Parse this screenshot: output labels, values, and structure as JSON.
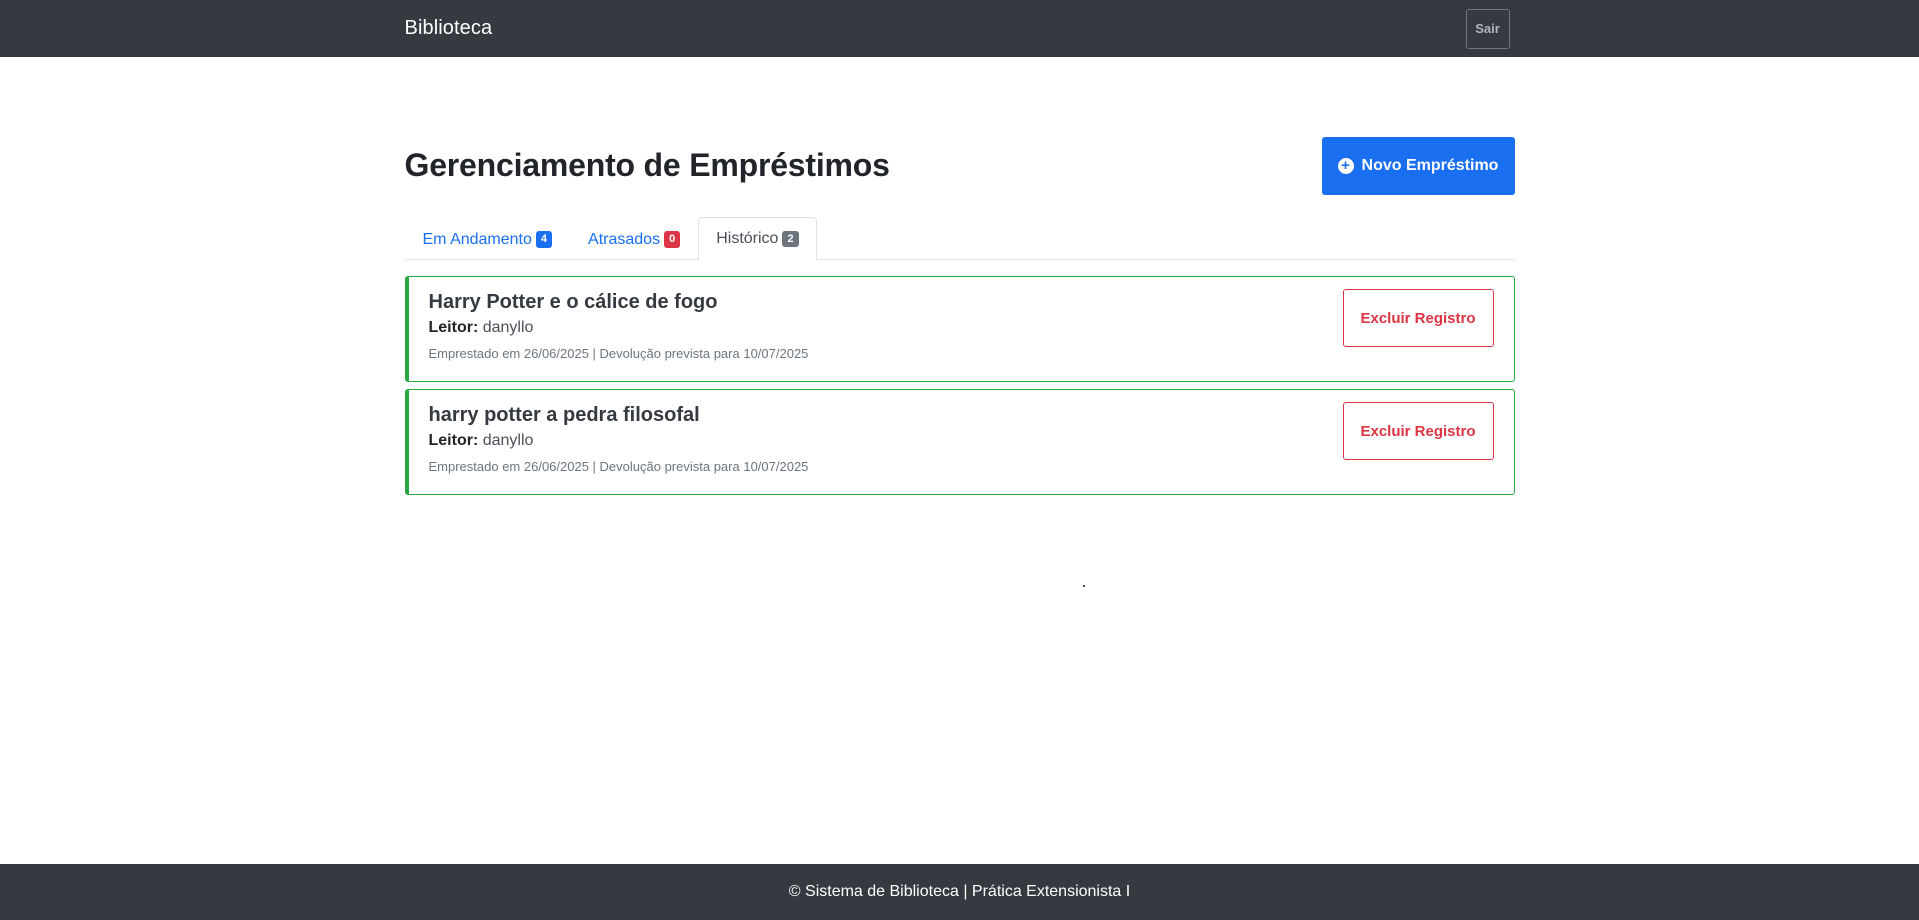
{
  "navbar": {
    "brand": "Biblioteca",
    "logout_label": "Sair"
  },
  "header": {
    "title": "Gerenciamento de Empréstimos",
    "new_button_label": "Novo Empréstimo",
    "new_button_icon": "plus-circle-icon"
  },
  "tabs": [
    {
      "label": "Em Andamento",
      "count": "4",
      "badge_color": "#1a6ff1",
      "active": false
    },
    {
      "label": "Atrasados",
      "count": "0",
      "badge_color": "#dc3545",
      "active": false
    },
    {
      "label": "Histórico",
      "count": "2",
      "badge_color": "#6c757d",
      "active": true
    }
  ],
  "loans": [
    {
      "title": "Harry Potter e o cálice de fogo",
      "reader_label": "Leitor:",
      "reader": "danyllo",
      "dates": "Emprestado em 26/06/2025 | Devolução prevista para 10/07/2025",
      "delete_label": "Excluir Registro"
    },
    {
      "title": "harry potter a pedra filosofal",
      "reader_label": "Leitor:",
      "reader": "danyllo",
      "dates": "Emprestado em 26/06/2025 | Devolução prevista para 10/07/2025",
      "delete_label": "Excluir Registro"
    }
  ],
  "footer": {
    "text": "© Sistema de Biblioteca | Prática Extensionista I"
  },
  "colors": {
    "navbar_bg": "#343a40",
    "primary": "#1a6ff1",
    "danger": "#dc3545",
    "success_border": "#28a745",
    "secondary": "#6c757d"
  }
}
